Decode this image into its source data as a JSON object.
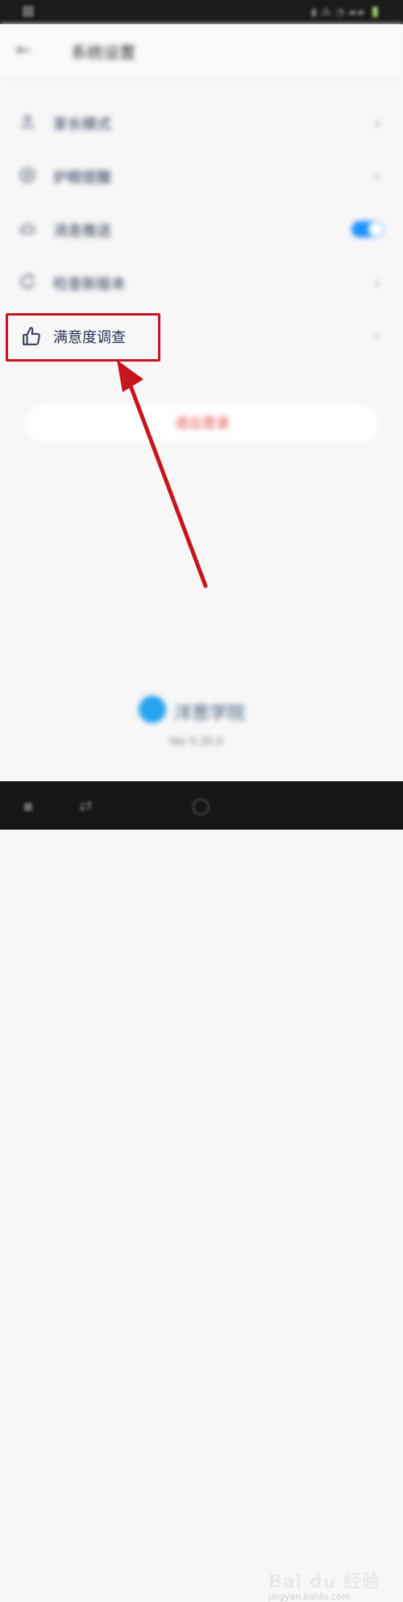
{
  "header": {
    "back_icon": "←",
    "title": "系统设置"
  },
  "settings": {
    "items": [
      {
        "label": "家长模式",
        "icon": "user-icon",
        "control": "chevron"
      },
      {
        "label": "护眼提醒",
        "icon": "eye-icon",
        "control": "chevron"
      },
      {
        "label": "消息推送",
        "icon": "cloud-icon",
        "control": "toggle",
        "toggle_on": true
      },
      {
        "label": "检查新版本",
        "icon": "update-icon",
        "control": "chevron"
      },
      {
        "label": "满意度调查",
        "icon": "thumbs-up-icon",
        "control": "chevron",
        "highlighted": true
      }
    ],
    "chevron": "›"
  },
  "logout": {
    "label": "退出登录"
  },
  "footer": {
    "brand": "洋葱学院",
    "version": "Ver 5.35.0"
  },
  "watermark": {
    "main": "Bai du 经验",
    "sub": "jingyan.baidu.com"
  },
  "colors": {
    "accent": "#1e90ff",
    "highlight": "#c6151c",
    "logout": "#e34a4a"
  }
}
